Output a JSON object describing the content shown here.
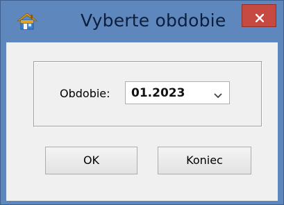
{
  "window": {
    "title": "Vyberte obdobie",
    "icon": "house-icon",
    "close_icon": "close-icon",
    "colors": {
      "titlebar": "#5e87bd",
      "close_button": "#c74a42",
      "client_background": "#f0f0f0"
    }
  },
  "form": {
    "period_label": "Obdobie:",
    "period_value": "01.2023",
    "period_dropdown_icon": "chevron-down-icon"
  },
  "buttons": {
    "ok_label": "OK",
    "cancel_label": "Koniec"
  }
}
